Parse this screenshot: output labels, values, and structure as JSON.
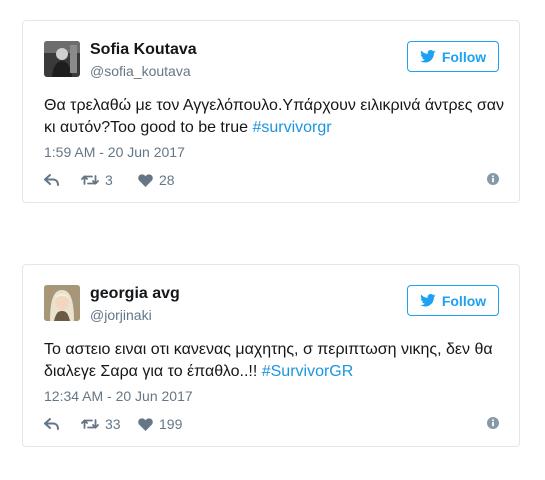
{
  "tweets": [
    {
      "author": {
        "name": "Sofia Koutava",
        "handle": "@sofia_koutava"
      },
      "follow_label": "Follow",
      "text_before": "Θα τρελαθώ με τον Αγγελόπουλο.Υπάρχουν ειλικρινά άντρες σαν κι αυτόν?Too good to be true ",
      "hashtag": "#survivorgr",
      "timestamp": "1:59 AM - 20 Jun 2017",
      "retweets": "3",
      "likes": "28"
    },
    {
      "author": {
        "name": "georgia avg",
        "handle": "@jorjinaki"
      },
      "follow_label": "Follow",
      "text_before": "Το αστειο ειναι οτι κανενας μαχητης, σ περιπτωση νικης, δεν θα διαλεγε Σαρα για το έπαθλο..!! ",
      "hashtag": "#SurvivorGR",
      "timestamp": "12:34 AM - 20 Jun 2017",
      "retweets": "33",
      "likes": "199"
    }
  ],
  "icons": {
    "brand": "twitter-bird-icon",
    "reply": "reply-icon",
    "retweet": "retweet-icon",
    "like": "heart-icon",
    "info": "info-icon"
  },
  "colors": {
    "accent": "#1da1f2",
    "hashtag": "#1b95e0",
    "muted_text": "#657786",
    "border": "#e1e8ed"
  }
}
